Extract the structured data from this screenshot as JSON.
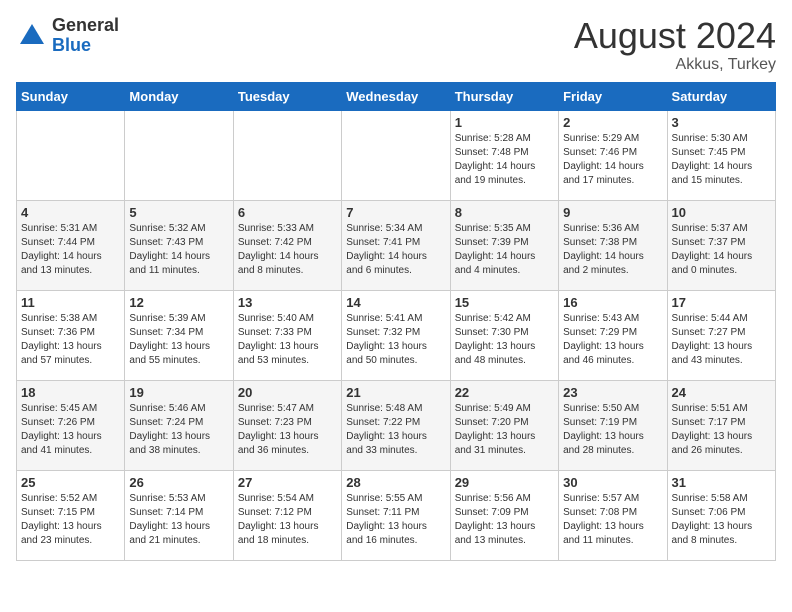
{
  "logo": {
    "general": "General",
    "blue": "Blue"
  },
  "title": {
    "month_year": "August 2024",
    "location": "Akkus, Turkey"
  },
  "days_of_week": [
    "Sunday",
    "Monday",
    "Tuesday",
    "Wednesday",
    "Thursday",
    "Friday",
    "Saturday"
  ],
  "weeks": [
    [
      {
        "day": "",
        "info": ""
      },
      {
        "day": "",
        "info": ""
      },
      {
        "day": "",
        "info": ""
      },
      {
        "day": "",
        "info": ""
      },
      {
        "day": "1",
        "info": "Sunrise: 5:28 AM\nSunset: 7:48 PM\nDaylight: 14 hours\nand 19 minutes."
      },
      {
        "day": "2",
        "info": "Sunrise: 5:29 AM\nSunset: 7:46 PM\nDaylight: 14 hours\nand 17 minutes."
      },
      {
        "day": "3",
        "info": "Sunrise: 5:30 AM\nSunset: 7:45 PM\nDaylight: 14 hours\nand 15 minutes."
      }
    ],
    [
      {
        "day": "4",
        "info": "Sunrise: 5:31 AM\nSunset: 7:44 PM\nDaylight: 14 hours\nand 13 minutes."
      },
      {
        "day": "5",
        "info": "Sunrise: 5:32 AM\nSunset: 7:43 PM\nDaylight: 14 hours\nand 11 minutes."
      },
      {
        "day": "6",
        "info": "Sunrise: 5:33 AM\nSunset: 7:42 PM\nDaylight: 14 hours\nand 8 minutes."
      },
      {
        "day": "7",
        "info": "Sunrise: 5:34 AM\nSunset: 7:41 PM\nDaylight: 14 hours\nand 6 minutes."
      },
      {
        "day": "8",
        "info": "Sunrise: 5:35 AM\nSunset: 7:39 PM\nDaylight: 14 hours\nand 4 minutes."
      },
      {
        "day": "9",
        "info": "Sunrise: 5:36 AM\nSunset: 7:38 PM\nDaylight: 14 hours\nand 2 minutes."
      },
      {
        "day": "10",
        "info": "Sunrise: 5:37 AM\nSunset: 7:37 PM\nDaylight: 14 hours\nand 0 minutes."
      }
    ],
    [
      {
        "day": "11",
        "info": "Sunrise: 5:38 AM\nSunset: 7:36 PM\nDaylight: 13 hours\nand 57 minutes."
      },
      {
        "day": "12",
        "info": "Sunrise: 5:39 AM\nSunset: 7:34 PM\nDaylight: 13 hours\nand 55 minutes."
      },
      {
        "day": "13",
        "info": "Sunrise: 5:40 AM\nSunset: 7:33 PM\nDaylight: 13 hours\nand 53 minutes."
      },
      {
        "day": "14",
        "info": "Sunrise: 5:41 AM\nSunset: 7:32 PM\nDaylight: 13 hours\nand 50 minutes."
      },
      {
        "day": "15",
        "info": "Sunrise: 5:42 AM\nSunset: 7:30 PM\nDaylight: 13 hours\nand 48 minutes."
      },
      {
        "day": "16",
        "info": "Sunrise: 5:43 AM\nSunset: 7:29 PM\nDaylight: 13 hours\nand 46 minutes."
      },
      {
        "day": "17",
        "info": "Sunrise: 5:44 AM\nSunset: 7:27 PM\nDaylight: 13 hours\nand 43 minutes."
      }
    ],
    [
      {
        "day": "18",
        "info": "Sunrise: 5:45 AM\nSunset: 7:26 PM\nDaylight: 13 hours\nand 41 minutes."
      },
      {
        "day": "19",
        "info": "Sunrise: 5:46 AM\nSunset: 7:24 PM\nDaylight: 13 hours\nand 38 minutes."
      },
      {
        "day": "20",
        "info": "Sunrise: 5:47 AM\nSunset: 7:23 PM\nDaylight: 13 hours\nand 36 minutes."
      },
      {
        "day": "21",
        "info": "Sunrise: 5:48 AM\nSunset: 7:22 PM\nDaylight: 13 hours\nand 33 minutes."
      },
      {
        "day": "22",
        "info": "Sunrise: 5:49 AM\nSunset: 7:20 PM\nDaylight: 13 hours\nand 31 minutes."
      },
      {
        "day": "23",
        "info": "Sunrise: 5:50 AM\nSunset: 7:19 PM\nDaylight: 13 hours\nand 28 minutes."
      },
      {
        "day": "24",
        "info": "Sunrise: 5:51 AM\nSunset: 7:17 PM\nDaylight: 13 hours\nand 26 minutes."
      }
    ],
    [
      {
        "day": "25",
        "info": "Sunrise: 5:52 AM\nSunset: 7:15 PM\nDaylight: 13 hours\nand 23 minutes."
      },
      {
        "day": "26",
        "info": "Sunrise: 5:53 AM\nSunset: 7:14 PM\nDaylight: 13 hours\nand 21 minutes."
      },
      {
        "day": "27",
        "info": "Sunrise: 5:54 AM\nSunset: 7:12 PM\nDaylight: 13 hours\nand 18 minutes."
      },
      {
        "day": "28",
        "info": "Sunrise: 5:55 AM\nSunset: 7:11 PM\nDaylight: 13 hours\nand 16 minutes."
      },
      {
        "day": "29",
        "info": "Sunrise: 5:56 AM\nSunset: 7:09 PM\nDaylight: 13 hours\nand 13 minutes."
      },
      {
        "day": "30",
        "info": "Sunrise: 5:57 AM\nSunset: 7:08 PM\nDaylight: 13 hours\nand 11 minutes."
      },
      {
        "day": "31",
        "info": "Sunrise: 5:58 AM\nSunset: 7:06 PM\nDaylight: 13 hours\nand 8 minutes."
      }
    ]
  ]
}
